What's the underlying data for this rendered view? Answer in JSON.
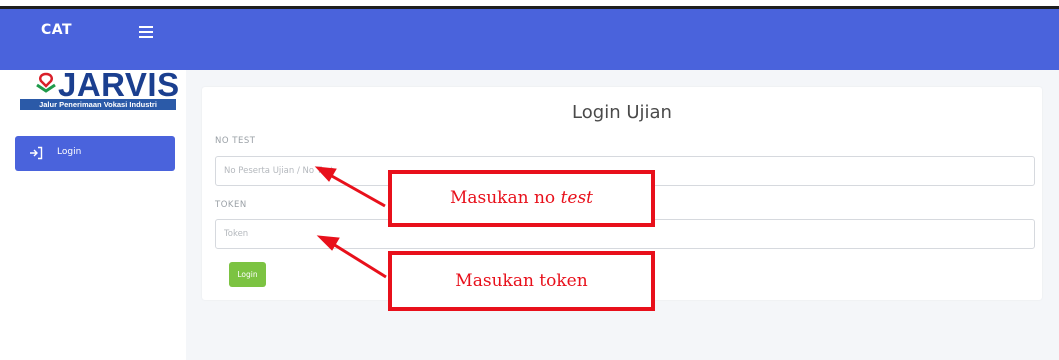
{
  "sidebar": {
    "brand": "CAT",
    "logo": {
      "name": "JARVIS",
      "tagline": "Jalur Penerimaan Vokasi Industri"
    },
    "items": [
      {
        "label": "Login",
        "icon": "sign-in-icon"
      }
    ]
  },
  "login_form": {
    "title": "Login Ujian",
    "no_test_label": "NO TEST",
    "no_test_placeholder": "No Peserta Ujian / No Test",
    "token_label": "TOKEN",
    "token_placeholder": "Token",
    "submit_label": "Login"
  },
  "annotations": {
    "no_test_prefix": "Masukan no ",
    "no_test_emphasis": "test",
    "token": "Masukan token"
  },
  "colors": {
    "header": "#4a63dc",
    "login_button": "#7cc342",
    "annotation": "#e8101b"
  }
}
